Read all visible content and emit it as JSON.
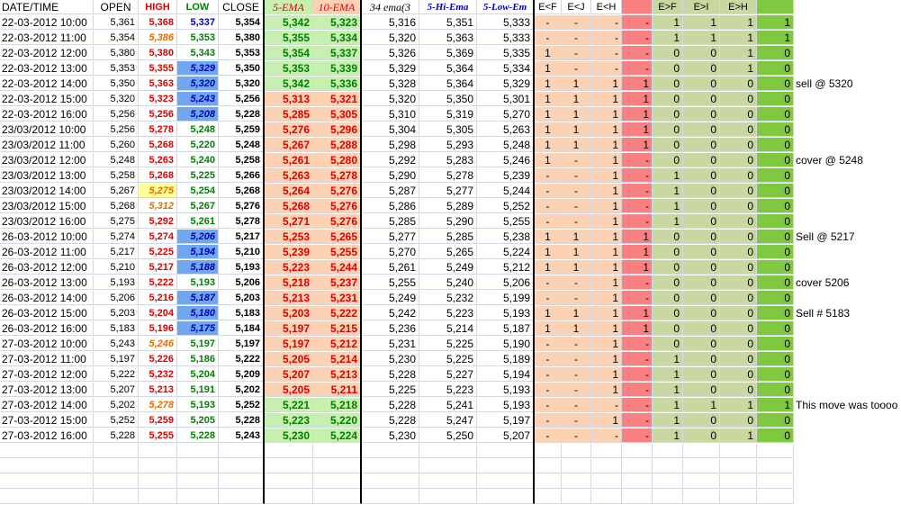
{
  "headers": [
    "DATE/TIME",
    "OPEN",
    "HIGH",
    "LOW",
    "CLOSE",
    "5-EMA",
    "10-EMA",
    "34 ema(3",
    "5-Hi-Ema",
    "5-Low-Em",
    "E<F",
    "E<J",
    "E<H",
    "",
    "E>F",
    "E>I",
    "E>H",
    ""
  ],
  "rows": [
    {
      "dt": "22-03-2012 10:00",
      "open": "5,361",
      "high": "5,368",
      "low": "5,337",
      "close": "5,354",
      "e5": "5,342",
      "e10": "5,323",
      "e34": "5,316",
      "hi": "5,351",
      "lo": "5,333",
      "f1": "-",
      "f2": "-",
      "f3": "-",
      "f4": "-",
      "g1": "1",
      "g2": "1",
      "g3": "1",
      "g4": "1",
      "note": ""
    },
    {
      "dt": "22-03-2012 11:00",
      "open": "5,354",
      "high": "5,386",
      "low": "5,353",
      "close": "5,380",
      "e5": "5,355",
      "e10": "5,334",
      "e34": "5,320",
      "hi": "5,363",
      "lo": "5,333",
      "f1": "-",
      "f2": "-",
      "f3": "-",
      "f4": "-",
      "g1": "1",
      "g2": "1",
      "g3": "1",
      "g4": "1",
      "note": ""
    },
    {
      "dt": "22-03-2012 12:00",
      "open": "5,380",
      "high": "5,380",
      "low": "5,343",
      "close": "5,353",
      "e5": "5,354",
      "e10": "5,337",
      "e34": "5,326",
      "hi": "5,369",
      "lo": "5,335",
      "f1": "1",
      "f2": "-",
      "f3": "-",
      "f4": "-",
      "g1": "0",
      "g2": "0",
      "g3": "1",
      "g4": "0",
      "note": ""
    },
    {
      "dt": "22-03-2012 13:00",
      "open": "5,353",
      "high": "5,355",
      "low": "5,329",
      "close": "5,350",
      "e5": "5,353",
      "e10": "5,339",
      "e34": "5,329",
      "hi": "5,364",
      "lo": "5,334",
      "f1": "1",
      "f2": "-",
      "f3": "-",
      "f4": "-",
      "g1": "0",
      "g2": "0",
      "g3": "1",
      "g4": "0",
      "note": ""
    },
    {
      "dt": "22-03-2012 14:00",
      "open": "5,350",
      "high": "5,363",
      "low": "5,320",
      "close": "5,320",
      "e5": "5,342",
      "e10": "5,336",
      "e34": "5,328",
      "hi": "5,364",
      "lo": "5,329",
      "f1": "1",
      "f2": "1",
      "f3": "1",
      "f4": "1",
      "g1": "0",
      "g2": "0",
      "g3": "0",
      "g4": "0",
      "note": "sell @ 5320"
    },
    {
      "dt": "22-03-2012 15:00",
      "open": "5,320",
      "high": "5,323",
      "low": "5,243",
      "close": "5,256",
      "e5": "5,313",
      "e10": "5,321",
      "e34": "5,320",
      "hi": "5,350",
      "lo": "5,301",
      "f1": "1",
      "f2": "1",
      "f3": "1",
      "f4": "1",
      "g1": "0",
      "g2": "0",
      "g3": "0",
      "g4": "0",
      "note": ""
    },
    {
      "dt": "22-03-2012 16:00",
      "open": "5,256",
      "high": "5,256",
      "low": "5,208",
      "close": "5,228",
      "e5": "5,285",
      "e10": "5,305",
      "e34": "5,310",
      "hi": "5,319",
      "lo": "5,270",
      "f1": "1",
      "f2": "1",
      "f3": "1",
      "f4": "1",
      "g1": "0",
      "g2": "0",
      "g3": "0",
      "g4": "0",
      "note": ""
    },
    {
      "dt": "23/03/2012 10:00",
      "open": "5,256",
      "high": "5,278",
      "low": "5,248",
      "close": "5,259",
      "e5": "5,276",
      "e10": "5,296",
      "e34": "5,304",
      "hi": "5,305",
      "lo": "5,263",
      "f1": "1",
      "f2": "1",
      "f3": "1",
      "f4": "1",
      "g1": "0",
      "g2": "0",
      "g3": "0",
      "g4": "0",
      "note": ""
    },
    {
      "dt": "23/03/2012 11:00",
      "open": "5,260",
      "high": "5,268",
      "low": "5,220",
      "close": "5,248",
      "e5": "5,267",
      "e10": "5,288",
      "e34": "5,298",
      "hi": "5,293",
      "lo": "5,248",
      "f1": "1",
      "f2": "1",
      "f3": "1",
      "f4": "1",
      "g1": "0",
      "g2": "0",
      "g3": "0",
      "g4": "0",
      "note": ""
    },
    {
      "dt": "23/03/2012 12:00",
      "open": "5,248",
      "high": "5,263",
      "low": "5,240",
      "close": "5,258",
      "e5": "5,261",
      "e10": "5,280",
      "e34": "5,292",
      "hi": "5,283",
      "lo": "5,246",
      "f1": "1",
      "f2": "-",
      "f3": "1",
      "f4": "-",
      "g1": "0",
      "g2": "0",
      "g3": "0",
      "g4": "0",
      "note": "cover @ 5248"
    },
    {
      "dt": "23/03/2012 13:00",
      "open": "5,258",
      "high": "5,268",
      "low": "5,225",
      "close": "5,266",
      "e5": "5,263",
      "e10": "5,278",
      "e34": "5,290",
      "hi": "5,278",
      "lo": "5,239",
      "f1": "-",
      "f2": "-",
      "f3": "1",
      "f4": "-",
      "g1": "1",
      "g2": "0",
      "g3": "0",
      "g4": "0",
      "note": ""
    },
    {
      "dt": "23/03/2012 14:00",
      "open": "5,267",
      "high": "5,275",
      "low": "5,254",
      "close": "5,268",
      "e5": "5,264",
      "e10": "5,276",
      "e34": "5,287",
      "hi": "5,277",
      "lo": "5,244",
      "f1": "-",
      "f2": "-",
      "f3": "1",
      "f4": "-",
      "g1": "1",
      "g2": "0",
      "g3": "0",
      "g4": "0",
      "note": ""
    },
    {
      "dt": "23/03/2012 15:00",
      "open": "5,268",
      "high": "5,312",
      "low": "5,267",
      "close": "5,276",
      "e5": "5,268",
      "e10": "5,276",
      "e34": "5,286",
      "hi": "5,289",
      "lo": "5,252",
      "f1": "-",
      "f2": "-",
      "f3": "1",
      "f4": "-",
      "g1": "1",
      "g2": "0",
      "g3": "0",
      "g4": "0",
      "note": ""
    },
    {
      "dt": "23/03/2012 16:00",
      "open": "5,275",
      "high": "5,292",
      "low": "5,261",
      "close": "5,278",
      "e5": "5,271",
      "e10": "5,276",
      "e34": "5,285",
      "hi": "5,290",
      "lo": "5,255",
      "f1": "-",
      "f2": "-",
      "f3": "1",
      "f4": "-",
      "g1": "1",
      "g2": "0",
      "g3": "0",
      "g4": "0",
      "note": ""
    },
    {
      "dt": "26-03-2012 10:00",
      "open": "5,274",
      "high": "5,274",
      "low": "5,206",
      "close": "5,217",
      "e5": "5,253",
      "e10": "5,265",
      "e34": "5,277",
      "hi": "5,285",
      "lo": "5,238",
      "f1": "1",
      "f2": "1",
      "f3": "1",
      "f4": "1",
      "g1": "0",
      "g2": "0",
      "g3": "0",
      "g4": "0",
      "note": "Sell @ 5217"
    },
    {
      "dt": "26-03-2012 11:00",
      "open": "5,217",
      "high": "5,225",
      "low": "5,194",
      "close": "5,210",
      "e5": "5,239",
      "e10": "5,255",
      "e34": "5,270",
      "hi": "5,265",
      "lo": "5,224",
      "f1": "1",
      "f2": "1",
      "f3": "1",
      "f4": "1",
      "g1": "0",
      "g2": "0",
      "g3": "0",
      "g4": "0",
      "note": ""
    },
    {
      "dt": "26-03-2012 12:00",
      "open": "5,210",
      "high": "5,217",
      "low": "5,188",
      "close": "5,193",
      "e5": "5,223",
      "e10": "5,244",
      "e34": "5,261",
      "hi": "5,249",
      "lo": "5,212",
      "f1": "1",
      "f2": "1",
      "f3": "1",
      "f4": "1",
      "g1": "0",
      "g2": "0",
      "g3": "0",
      "g4": "0",
      "note": ""
    },
    {
      "dt": "26-03-2012 13:00",
      "open": "5,193",
      "high": "5,222",
      "low": "5,193",
      "close": "5,206",
      "e5": "5,218",
      "e10": "5,237",
      "e34": "5,255",
      "hi": "5,240",
      "lo": "5,206",
      "f1": "-",
      "f2": "-",
      "f3": "1",
      "f4": "-",
      "g1": "0",
      "g2": "0",
      "g3": "0",
      "g4": "0",
      "note": "cover 5206"
    },
    {
      "dt": "26-03-2012 14:00",
      "open": "5,206",
      "high": "5,216",
      "low": "5,187",
      "close": "5,203",
      "e5": "5,213",
      "e10": "5,231",
      "e34": "5,249",
      "hi": "5,232",
      "lo": "5,199",
      "f1": "-",
      "f2": "-",
      "f3": "1",
      "f4": "-",
      "g1": "0",
      "g2": "0",
      "g3": "0",
      "g4": "0",
      "note": ""
    },
    {
      "dt": "26-03-2012 15:00",
      "open": "5,203",
      "high": "5,204",
      "low": "5,180",
      "close": "5,183",
      "e5": "5,203",
      "e10": "5,222",
      "e34": "5,242",
      "hi": "5,223",
      "lo": "5,193",
      "f1": "1",
      "f2": "1",
      "f3": "1",
      "f4": "1",
      "g1": "0",
      "g2": "0",
      "g3": "0",
      "g4": "0",
      "note": "Sell # 5183"
    },
    {
      "dt": "26-03-2012 16:00",
      "open": "5,183",
      "high": "5,196",
      "low": "5,175",
      "close": "5,184",
      "e5": "5,197",
      "e10": "5,215",
      "e34": "5,236",
      "hi": "5,214",
      "lo": "5,187",
      "f1": "1",
      "f2": "1",
      "f3": "1",
      "f4": "1",
      "g1": "0",
      "g2": "0",
      "g3": "0",
      "g4": "0",
      "note": ""
    },
    {
      "dt": "27-03-2012 10:00",
      "open": "5,243",
      "high": "5,246",
      "low": "5,197",
      "close": "5,197",
      "e5": "5,197",
      "e10": "5,212",
      "e34": "5,231",
      "hi": "5,225",
      "lo": "5,190",
      "f1": "-",
      "f2": "-",
      "f3": "1",
      "f4": "-",
      "g1": "0",
      "g2": "0",
      "g3": "0",
      "g4": "0",
      "note": ""
    },
    {
      "dt": "27-03-2012 11:00",
      "open": "5,197",
      "high": "5,226",
      "low": "5,186",
      "close": "5,222",
      "e5": "5,205",
      "e10": "5,214",
      "e34": "5,230",
      "hi": "5,225",
      "lo": "5,189",
      "f1": "-",
      "f2": "-",
      "f3": "1",
      "f4": "-",
      "g1": "1",
      "g2": "0",
      "g3": "0",
      "g4": "0",
      "note": ""
    },
    {
      "dt": "27-03-2012 12:00",
      "open": "5,222",
      "high": "5,232",
      "low": "5,204",
      "close": "5,209",
      "e5": "5,207",
      "e10": "5,213",
      "e34": "5,228",
      "hi": "5,227",
      "lo": "5,194",
      "f1": "-",
      "f2": "-",
      "f3": "1",
      "f4": "-",
      "g1": "1",
      "g2": "0",
      "g3": "0",
      "g4": "0",
      "note": ""
    },
    {
      "dt": "27-03-2012 13:00",
      "open": "5,207",
      "high": "5,213",
      "low": "5,191",
      "close": "5,202",
      "e5": "5,205",
      "e10": "5,211",
      "e34": "5,225",
      "hi": "5,223",
      "lo": "5,193",
      "f1": "-",
      "f2": "-",
      "f3": "1",
      "f4": "-",
      "g1": "1",
      "g2": "0",
      "g3": "0",
      "g4": "0",
      "note": ""
    },
    {
      "dt": "27-03-2012 14:00",
      "open": "5,202",
      "high": "5,278",
      "low": "5,193",
      "close": "5,252",
      "e5": "5,221",
      "e10": "5,218",
      "e34": "5,228",
      "hi": "5,241",
      "lo": "5,193",
      "f1": "-",
      "f2": "-",
      "f3": "-",
      "f4": "-",
      "g1": "1",
      "g2": "1",
      "g3": "1",
      "g4": "1",
      "note": "This move was toooo"
    },
    {
      "dt": "27-03-2012 15:00",
      "open": "5,252",
      "high": "5,259",
      "low": "5,205",
      "close": "5,228",
      "e5": "5,223",
      "e10": "5,220",
      "e34": "5,228",
      "hi": "5,247",
      "lo": "5,197",
      "f1": "-",
      "f2": "-",
      "f3": "1",
      "f4": "-",
      "g1": "1",
      "g2": "0",
      "g3": "0",
      "g4": "0",
      "note": ""
    },
    {
      "dt": "27-03-2012 16:00",
      "open": "5,228",
      "high": "5,255",
      "low": "5,228",
      "close": "5,243",
      "e5": "5,230",
      "e10": "5,224",
      "e34": "5,230",
      "hi": "5,250",
      "lo": "5,207",
      "f1": "-",
      "f2": "-",
      "f3": "-",
      "f4": "-",
      "g1": "1",
      "g2": "0",
      "g3": "1",
      "g4": "0",
      "note": ""
    }
  ],
  "colors": {
    "ema_up": "#c6efb0",
    "ema_down": "#fcd2b4",
    "flag_pink": "#f88080",
    "flag_olive": "#c8d8a0",
    "flag_bright": "#80c840",
    "low_blue": "#6fa8f0"
  }
}
